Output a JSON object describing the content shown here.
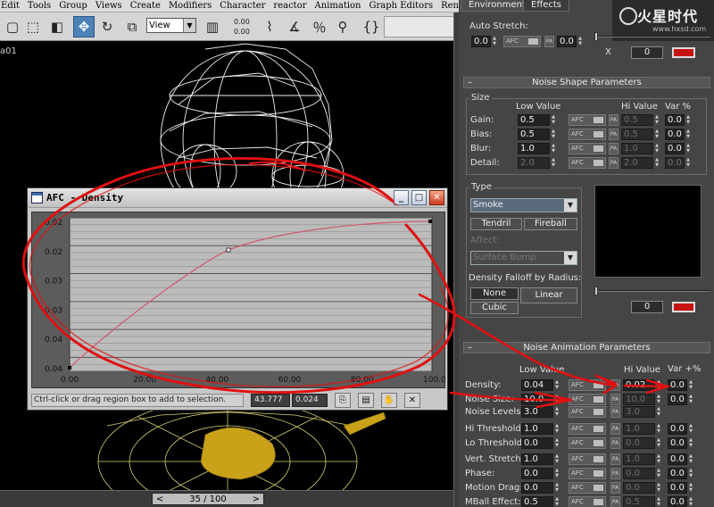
{
  "menu": [
    "Edit",
    "Tools",
    "Group",
    "Views",
    "Create",
    "Modifiers",
    "Character",
    "reactor",
    "Animation",
    "Graph Editors",
    "Render"
  ],
  "toolbar": {
    "view_select": "View",
    "mini_values": [
      "0.00",
      "0.00"
    ]
  },
  "viewport": {
    "label": "a01"
  },
  "timeline": {
    "frame": "35 / 100",
    "prev": "<",
    "next": ">"
  },
  "afc": {
    "title": "AFC - Density",
    "buttons": {
      "minimize": "_",
      "maximize": "□",
      "close": "✕"
    },
    "y_ticks": [
      "0.02",
      "0.02",
      "0.03",
      "0.03",
      "0.04",
      "0.04"
    ],
    "x_ticks": [
      "0.00",
      "20.00",
      "40.00",
      "60.00",
      "80.00",
      "100.00"
    ],
    "status": "Ctrl-click or drag region box to add to selection.",
    "coord_x": "43.777",
    "coord_y": "0.024",
    "tools": [
      "⎘",
      "▤",
      "✋",
      "✕"
    ]
  },
  "panel": {
    "tabs": [
      "Environment",
      "Effects"
    ],
    "logo": {
      "text": "火星时代",
      "url": "www.hxsd.com"
    },
    "auto_stretch": {
      "label": "Auto Stretch:",
      "value1": "0.0",
      "afc": "AFC",
      "pa": "PA",
      "value2": "0.0"
    },
    "top_x": "X",
    "top_num": "0",
    "noise_shape": {
      "title": "Noise Shape Parameters",
      "size_label": "Size",
      "low_label": "Low Value",
      "hi_label": "Hi Value",
      "var_label": "Var %",
      "rows": [
        {
          "label": "Gain:",
          "low": "0.5",
          "hi": "0.5",
          "var": "0.0"
        },
        {
          "label": "Bias:",
          "low": "0.5",
          "hi": "0.5",
          "var": "0.0"
        },
        {
          "label": "Blur:",
          "low": "1.0",
          "hi": "1.0",
          "var": "0.0"
        },
        {
          "label": "Detail:",
          "low": "2.0",
          "hi": "2.0",
          "var": "0.0"
        }
      ],
      "afc": "AFC",
      "pa": "PA"
    },
    "type": {
      "label": "Type",
      "select": "Smoke",
      "tendril": "Tendril",
      "fireball": "Fireball",
      "affect_label": "Affect:",
      "affect_select": "Surface Bump",
      "falloff_label": "Density Falloff by Radius:",
      "none": "None",
      "linear": "Linear",
      "cubic": "Cubic",
      "num": "0"
    },
    "noise_anim": {
      "title": "Noise Animation Parameters",
      "low_label": "Low Value",
      "hi_label": "Hi Value",
      "var_label": "Var +%",
      "rows": [
        {
          "label": "Density:",
          "low": "0.04",
          "hi": "0.02",
          "var": "0.0"
        },
        {
          "label": "Noise Size:",
          "low": "10.0",
          "hi": "10.0",
          "var": "0.0"
        },
        {
          "label": "Noise Levels:",
          "low": "3.0",
          "hi": "3.0",
          "var": ""
        },
        {
          "label": "Hi Threshold:",
          "low": "1.0",
          "hi": "1.0",
          "var": "0.0"
        },
        {
          "label": "Lo Threshold:",
          "low": "0.0",
          "hi": "0.0",
          "var": "0.0"
        },
        {
          "label": "Vert. Stretch:",
          "low": "1.0",
          "hi": "1.0",
          "var": "0.0"
        },
        {
          "label": "Phase:",
          "low": "0.0",
          "hi": "0.0",
          "var": "0.0"
        },
        {
          "label": "Motion Drag:",
          "low": "0.0",
          "hi": "0.0",
          "var": "0.0"
        },
        {
          "label": "MBall Effect:",
          "low": "0.5",
          "hi": "0.5",
          "var": "0.0"
        }
      ],
      "afc": "AFC",
      "pa": "PA"
    }
  },
  "colors": {
    "accent_blue": "#4d82b8",
    "annotation_red": "#e01010",
    "curve": "#d05a6e",
    "wireframe_white": "#f0f0f0",
    "wireframe_yellow": "#d8d070"
  }
}
